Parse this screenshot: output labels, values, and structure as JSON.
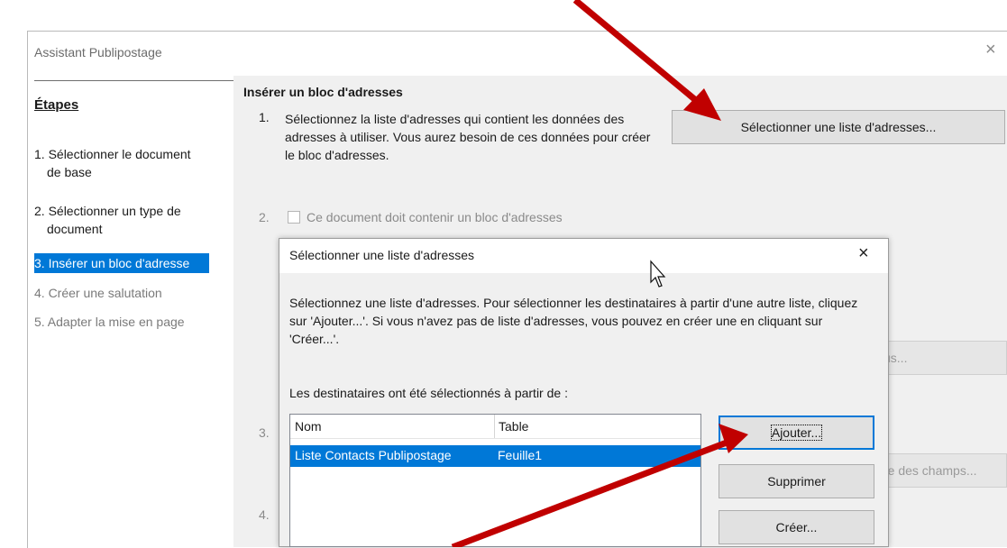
{
  "wizard": {
    "title": "Assistant Publipostage",
    "close_glyph": "×"
  },
  "steps": {
    "heading": "Étapes",
    "items": [
      {
        "line1": "1. Sélectionner le document",
        "line2": "de base",
        "state": "done"
      },
      {
        "line1": "2. Sélectionner un type de",
        "line2": "document",
        "state": "done"
      },
      {
        "line1": "3. Insérer un bloc d'adresse",
        "line2": "",
        "state": "active"
      },
      {
        "line1": "4. Créer une salutation",
        "line2": "",
        "state": "disabled"
      },
      {
        "line1": "5. Adapter la mise en page",
        "line2": "",
        "state": "disabled"
      }
    ]
  },
  "main": {
    "section_title": "Insérer un bloc d'adresses",
    "step1_number": "1.",
    "step1_text": "Sélectionnez la liste d'adresses qui contient les données des adresses à utiliser. Vous aurez besoin de ces données pour créer le bloc d'adresses.",
    "select_list_button": "Sélectionner une liste d'adresses...",
    "step2_number": "2.",
    "step2_checkbox_label": "Ce document doit contenir un bloc d'adresses",
    "step2_checked": false,
    "step3_number": "3.",
    "step4_number": "4.",
    "hidden_button_1_tail": "us...",
    "hidden_button_2_tail": "re des champs..."
  },
  "dialog": {
    "title": "Sélectionner une liste d'adresses",
    "close_glyph": "×",
    "description": "Sélectionnez une liste d'adresses. Pour sélectionner les destinataires à partir d'une autre liste, cliquez sur 'Ajouter...'. Si vous n'avez pas de liste d'adresses, vous pouvez en créer une en cliquant sur 'Créer...'.",
    "recipients_label": "Les destinataires ont été sélectionnés à partir de :",
    "columns": [
      "Nom",
      "Table"
    ],
    "rows": [
      {
        "nom": "Liste Contacts Publipostage",
        "table": "Feuille1",
        "selected": true
      }
    ],
    "buttons": {
      "add": "Ajouter...",
      "remove": "Supprimer",
      "create": "Créer..."
    }
  },
  "colors": {
    "accent": "#0078d7",
    "annotation_arrow": "#c00000",
    "pane_bg": "#f0f0f0"
  }
}
